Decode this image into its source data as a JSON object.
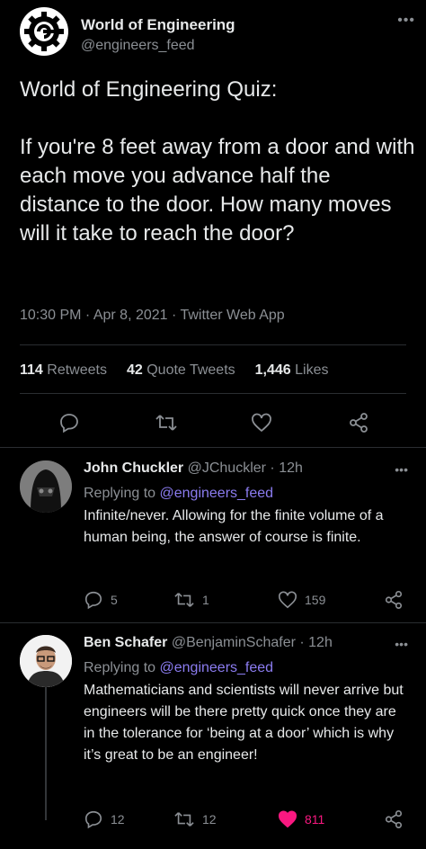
{
  "main_tweet": {
    "name": "World of Engineering",
    "handle": "@engineers_feed",
    "more": "•••",
    "text": "World of Engineering Quiz:\n\nIf you're 8 feet away from a door and with each move you advance half the distance to the door. How many moves will it take to reach the door?",
    "meta": "10:30 PM · Apr 8, 2021 · Twitter Web App",
    "stats": {
      "retweets_count": "114",
      "retweets_label": "Retweets",
      "quotes_count": "42",
      "quotes_label": "Quote Tweets",
      "likes_count": "1,446",
      "likes_label": "Likes"
    }
  },
  "replies": [
    {
      "name": "John Chuckler",
      "handle": "@JChuckler",
      "time": "· 12h",
      "replying_prefix": "Replying to",
      "replying_to": "@engineers_feed",
      "text": "Infinite/never.  Allowing for the finite volume of a human being, the answer of course is finite.",
      "reply_count": "5",
      "retweet_count": "1",
      "like_count": "159",
      "more": "•••"
    },
    {
      "name": "Ben Schafer",
      "handle": "@BenjaminSchafer",
      "time": "· 12h",
      "replying_prefix": "Replying to",
      "replying_to": "@engineers_feed",
      "text": "Mathematicians and scientists will never arrive but engineers will be there pretty quick once they are in the tolerance for ‘being at a door’ which is why it’s great to be an engineer!",
      "reply_count": "12",
      "retweet_count": "12",
      "like_count": "811",
      "more": "•••"
    }
  ],
  "colors": {
    "background": "#000000",
    "link": "#8b7cf0",
    "like_active": "#f91880",
    "muted": "#8b8f94"
  },
  "icons": [
    "reply-icon",
    "retweet-icon",
    "like-icon",
    "share-icon",
    "more-icon"
  ]
}
